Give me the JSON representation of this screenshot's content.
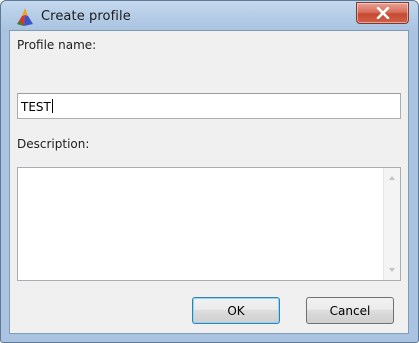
{
  "window": {
    "title": "Create profile",
    "app_icon": "app-logo-icon",
    "close_icon": "close-icon"
  },
  "form": {
    "profile_name_label": "Profile name:",
    "profile_name_value": "TEST",
    "description_label": "Description:",
    "description_value": ""
  },
  "buttons": {
    "ok_label": "OK",
    "cancel_label": "Cancel"
  },
  "colors": {
    "close_button": "#c44a31",
    "titlebar": "#b8cfe8",
    "client_background": "#f0f0f0",
    "default_button_border": "#3c7fb1"
  }
}
